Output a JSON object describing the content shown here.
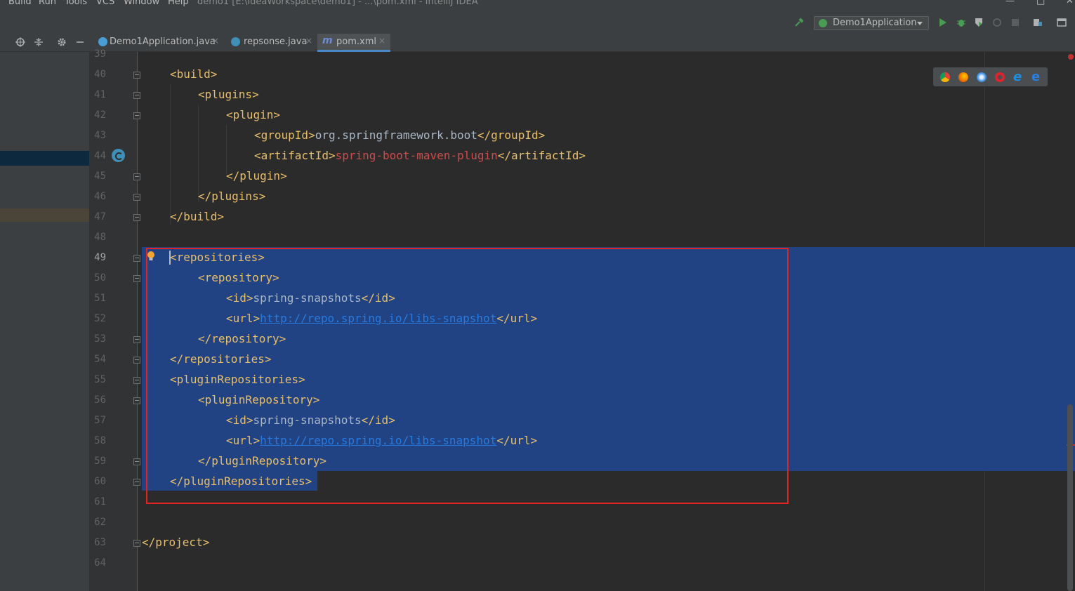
{
  "menubar": {
    "items": [
      "Build",
      "Run",
      "Tools",
      "VCS",
      "Window",
      "Help"
    ],
    "title": "demo1 [E:\\IdeaWorkspace\\demo1] - ...\\pom.xml - IntelliJ IDEA",
    "window_buttons": [
      "—",
      "□",
      "✕"
    ]
  },
  "toolbar": {
    "run_config": "Demo1Application",
    "icons": [
      "build-hammer-icon",
      "run-icon",
      "debug-icon",
      "coverage-icon",
      "profile-icon",
      "stop-icon",
      "project-structure-icon",
      "layout-icon"
    ]
  },
  "tabs": [
    {
      "label": "Demo1Application.java",
      "icon": "spring-class-icon",
      "icon_color": "#4a9ed8",
      "active": false
    },
    {
      "label": "repsonse.java",
      "icon": "class-icon",
      "icon_color": "#3f8fb8",
      "active": false
    },
    {
      "label": "pom.xml",
      "icon": "maven-icon",
      "icon_color": "#6c8cd5",
      "active": true
    }
  ],
  "tab_close_glyph": "×",
  "tool_icons": [
    "target-icon",
    "collapse-all-icon",
    "gear-icon",
    "minimize-icon"
  ],
  "browser_icons": [
    "chrome-icon",
    "firefox-icon",
    "safari-icon",
    "opera-icon",
    "ie-icon",
    "edge-icon"
  ],
  "lines": [
    {
      "num": "39",
      "parts": []
    },
    {
      "num": "40",
      "indent": 1,
      "parts": [
        {
          "t": "tag",
          "v": "<build>"
        }
      ]
    },
    {
      "num": "41",
      "indent": 2,
      "parts": [
        {
          "t": "tag",
          "v": "<plugins>"
        }
      ]
    },
    {
      "num": "42",
      "indent": 3,
      "parts": [
        {
          "t": "tag",
          "v": "<plugin>"
        }
      ]
    },
    {
      "num": "43",
      "indent": 4,
      "parts": [
        {
          "t": "tag",
          "v": "<groupId>"
        },
        {
          "t": "txt",
          "v": "org.springframework.boot"
        },
        {
          "t": "tag",
          "v": "</groupId>"
        }
      ]
    },
    {
      "num": "44",
      "indent": 4,
      "parts": [
        {
          "t": "tag",
          "v": "<artifactId>"
        },
        {
          "t": "txt-red",
          "v": "spring-boot-maven-plugin"
        },
        {
          "t": "tag",
          "v": "</artifactId>"
        }
      ]
    },
    {
      "num": "45",
      "indent": 3,
      "parts": [
        {
          "t": "tag",
          "v": "</plugin>"
        }
      ]
    },
    {
      "num": "46",
      "indent": 2,
      "parts": [
        {
          "t": "tag",
          "v": "</plugins>"
        }
      ]
    },
    {
      "num": "47",
      "indent": 1,
      "parts": [
        {
          "t": "tag",
          "v": "</build>"
        }
      ]
    },
    {
      "num": "48",
      "parts": []
    },
    {
      "num": "49",
      "indent": 1,
      "parts": [
        {
          "t": "tag",
          "v": "<repositories>"
        }
      ]
    },
    {
      "num": "50",
      "indent": 2,
      "parts": [
        {
          "t": "tag",
          "v": "<repository>"
        }
      ]
    },
    {
      "num": "51",
      "indent": 3,
      "parts": [
        {
          "t": "tag",
          "v": "<id>"
        },
        {
          "t": "txt",
          "v": "spring-snapshots"
        },
        {
          "t": "tag",
          "v": "</id>"
        }
      ]
    },
    {
      "num": "52",
      "indent": 3,
      "parts": [
        {
          "t": "tag",
          "v": "<url>"
        },
        {
          "t": "url",
          "v": "http://repo.spring.io/libs-snapshot"
        },
        {
          "t": "tag",
          "v": "</url>"
        }
      ]
    },
    {
      "num": "53",
      "indent": 2,
      "parts": [
        {
          "t": "tag",
          "v": "</repository>"
        }
      ]
    },
    {
      "num": "54",
      "indent": 1,
      "parts": [
        {
          "t": "tag",
          "v": "</repositories>"
        }
      ]
    },
    {
      "num": "55",
      "indent": 1,
      "parts": [
        {
          "t": "tag",
          "v": "<pluginRepositories>"
        }
      ]
    },
    {
      "num": "56",
      "indent": 2,
      "parts": [
        {
          "t": "tag",
          "v": "<pluginRepository>"
        }
      ]
    },
    {
      "num": "57",
      "indent": 3,
      "parts": [
        {
          "t": "tag",
          "v": "<id>"
        },
        {
          "t": "txt",
          "v": "spring-snapshots"
        },
        {
          "t": "tag",
          "v": "</id>"
        }
      ]
    },
    {
      "num": "58",
      "indent": 3,
      "parts": [
        {
          "t": "tag",
          "v": "<url>"
        },
        {
          "t": "url",
          "v": "http://repo.spring.io/libs-snapshot"
        },
        {
          "t": "tag",
          "v": "</url>"
        }
      ]
    },
    {
      "num": "59",
      "indent": 2,
      "parts": [
        {
          "t": "tag",
          "v": "</pluginRepository>"
        }
      ]
    },
    {
      "num": "60",
      "indent": 1,
      "parts": [
        {
          "t": "tag",
          "v": "</pluginRepositories>"
        }
      ]
    },
    {
      "num": "61",
      "parts": []
    },
    {
      "num": "62",
      "parts": []
    },
    {
      "num": "63",
      "indent": 0,
      "parts": [
        {
          "t": "tag",
          "v": "</project>"
        }
      ]
    },
    {
      "num": "64",
      "parts": []
    }
  ],
  "current_line": "49",
  "fold_lines": [
    "40",
    "41",
    "42",
    "45",
    "46",
    "47",
    "49",
    "50",
    "53",
    "54",
    "55",
    "56",
    "59",
    "60",
    "63"
  ]
}
